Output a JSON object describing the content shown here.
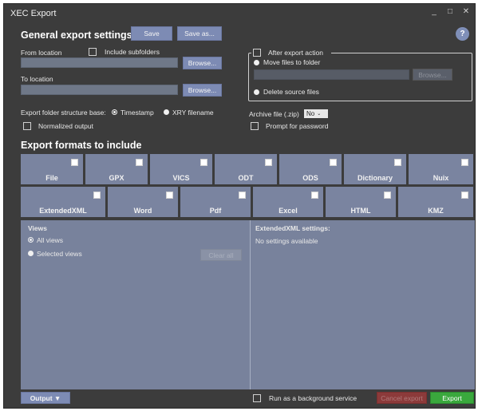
{
  "window": {
    "title": "XEC Export",
    "minimize": "_",
    "maximize": "□",
    "close": "✕",
    "help": "?"
  },
  "general": {
    "heading": "General export settings",
    "save": "Save",
    "save_as": "Save as...",
    "from_location": "From location",
    "include_subfolders": "Include subfolders",
    "browse": "Browse...",
    "to_location": "To location",
    "folder_structure_base": "Export folder structure base:",
    "timestamp": "Timestamp",
    "xry_filename": "XRY filename",
    "normalized_output": "Normalized output",
    "after_export_action": "After export action",
    "move_files": "Move files to folder",
    "move_browse": "Browse...",
    "delete_source": "Delete source files",
    "archive_label": "Archive file (.zip)",
    "archive_value": "No",
    "prompt_password": "Prompt for password"
  },
  "formats": {
    "heading": "Export formats to include",
    "row1": [
      "File",
      "GPX",
      "VICS",
      "ODT",
      "ODS",
      "Dictionary",
      "Nuix"
    ],
    "row2": [
      "ExtendedXML",
      "Word",
      "Pdf",
      "Excel",
      "HTML",
      "KMZ"
    ]
  },
  "views": {
    "heading": "Views",
    "all_views": "All views",
    "selected_views": "Selected views",
    "clear_all": "Clear all",
    "settings_heading": "ExtendedXML settings:",
    "no_settings": "No settings available"
  },
  "footer": {
    "output": "Output ▼",
    "background": "Run as a background service",
    "cancel": "Cancel export",
    "export": "Export"
  }
}
